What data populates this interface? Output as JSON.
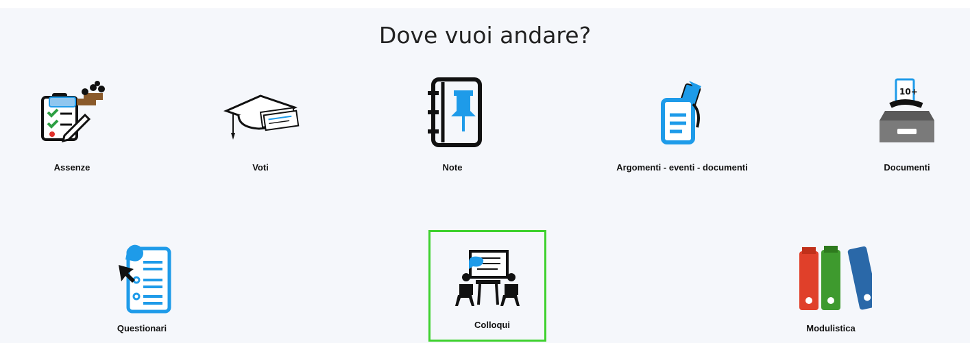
{
  "page": {
    "title": "Dove vuoi andare?"
  },
  "tiles": [
    {
      "label": "Assenze",
      "icon": "attendance-icon"
    },
    {
      "label": "Voti",
      "icon": "graduation-cap-icon"
    },
    {
      "label": "Note",
      "icon": "pinned-notebook-icon"
    },
    {
      "label": "Argomenti - eventi - documenti",
      "icon": "event-documents-icon"
    },
    {
      "label": "Documenti",
      "icon": "document-tray-icon"
    },
    {
      "label": "Questionari",
      "icon": "questionnaire-icon"
    },
    {
      "label": "Colloqui",
      "icon": "meeting-icon"
    },
    {
      "label": "Modulistica",
      "icon": "binders-icon"
    }
  ],
  "selected": "Colloqui",
  "colors": {
    "accent_blue": "#1e9be9",
    "selection_green": "#3ed12e",
    "background": "#f5f7fb"
  }
}
